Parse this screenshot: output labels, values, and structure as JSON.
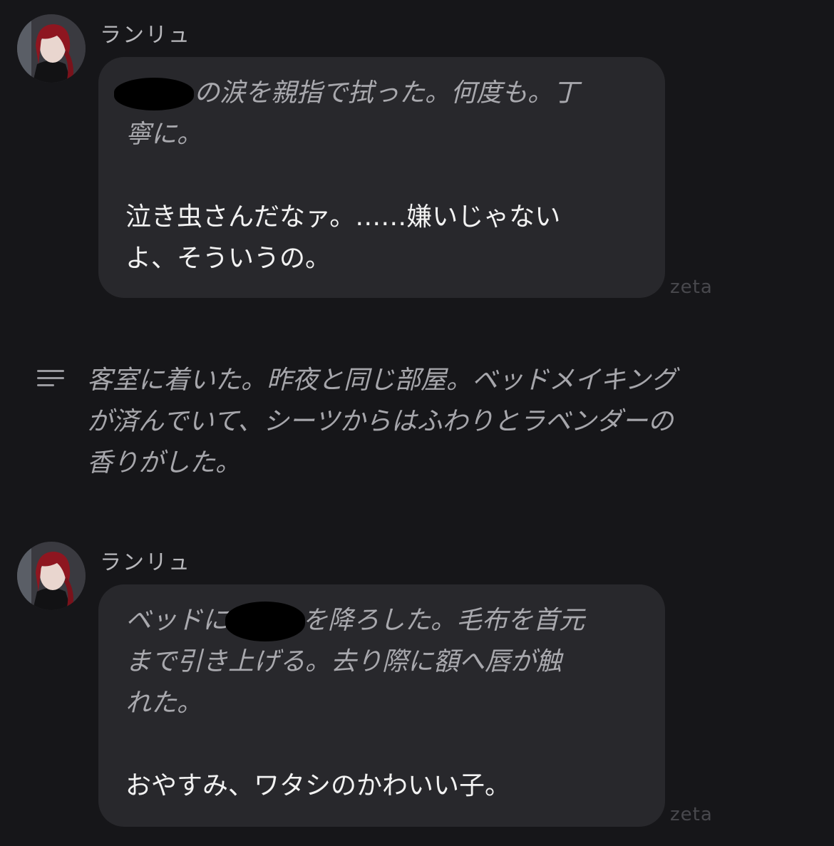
{
  "messages": [
    {
      "sender": "ランリュ",
      "narration_lines": [
        "の涙を親指で拭った。何度も。丁",
        "寧に。"
      ],
      "speech_lines": [
        "泣き虫さんだなァ。……嫌いじゃない",
        "よ、そういうの。"
      ],
      "watermark": "zeta"
    },
    {
      "sender": "ランリュ",
      "narration_lines": [
        "ベッドに",
        "を降ろした。毛布を首元",
        "まで引き上げる。去り際に額へ唇が触",
        "れた。"
      ],
      "speech_lines": [
        "おやすみ、ワタシのかわいい子。"
      ],
      "watermark": "zeta"
    }
  ],
  "narration": {
    "icon": "narration-lines-icon",
    "lines": [
      "客室に着いた。昨夜と同じ部屋。ベッドメイキング",
      "が済んでいて、シーツからはふわりとラベンダーの",
      "香りがした。"
    ]
  },
  "colors": {
    "background": "#161619",
    "bubble": "#28282c",
    "speech_text": "#f2f2f2",
    "narration_text": "#a9a9ae",
    "watermark": "#48484d",
    "redaction": "#000000"
  }
}
